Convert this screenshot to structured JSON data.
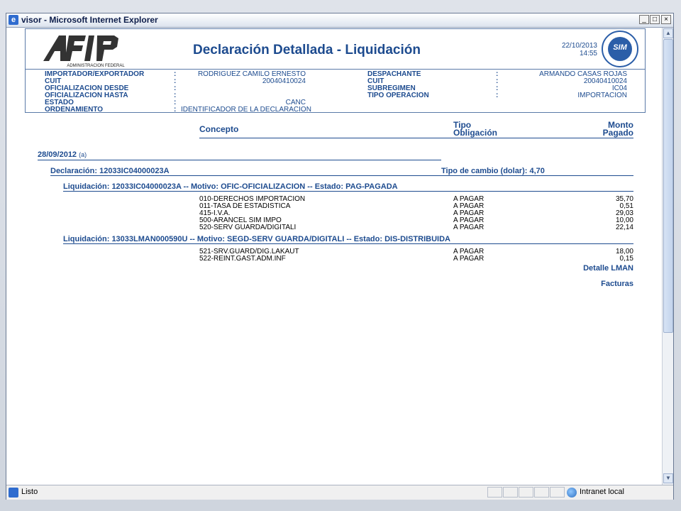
{
  "window": {
    "title": "visor - Microsoft Internet Explorer",
    "buttons": {
      "minimize": "_",
      "maximize": "□",
      "close": "×"
    }
  },
  "header": {
    "logo_text": "AFIP",
    "logo_subtitle": "ADMINISTRACION FEDERAL",
    "title": "Declaración Detallada - Liquidación",
    "date": "22/10/2013",
    "time": "14:55",
    "seal_text": "SIM"
  },
  "info": {
    "left": [
      {
        "label": "IMPORTADOR/EXPORTADOR",
        "value": "RODRIGUEZ CAMILO ERNESTO"
      },
      {
        "label": "CUIT",
        "value": "20040410024"
      },
      {
        "label": "OFICIALIZACION DESDE",
        "value": ""
      },
      {
        "label": "OFICIALIZACION HASTA",
        "value": ""
      },
      {
        "label": "ESTADO",
        "value": "CANC"
      },
      {
        "label": "ORDENAMIENTO",
        "value": "IDENTIFICADOR DE LA DECLARACION"
      }
    ],
    "right": [
      {
        "label": "DESPACHANTE",
        "value": "ARMANDO CASAS ROJAS"
      },
      {
        "label": "CUIT",
        "value": "20040410024"
      },
      {
        "label": "SUBREGIMEN",
        "value": "IC04"
      },
      {
        "label": "TIPO OPERACION",
        "value": "IMPORTACION"
      }
    ]
  },
  "columns": {
    "concepto": "Concepto",
    "tipo_1": "Tipo",
    "tipo_2": "Obligación",
    "monto_1": "Monto",
    "monto_2": "Pagado"
  },
  "date_group": {
    "date": "28/09/2012",
    "note": "(a)"
  },
  "declaracion": {
    "label": "Declaración: 12033IC04000023A",
    "tipo_cambio": "Tipo de cambio (dolar): 4,70"
  },
  "liquidaciones": [
    {
      "title": "Liquidación: 12033IC04000023A  -- Motivo: OFIC-OFICIALIZACION  -- Estado: PAG-PAGADA",
      "items": [
        {
          "concepto": "010-DERECHOS IMPORTACION",
          "tipo": "A PAGAR",
          "monto": "35,70"
        },
        {
          "concepto": "011-TASA DE ESTADISTICA",
          "tipo": "A PAGAR",
          "monto": "0,51"
        },
        {
          "concepto": "415-I.V.A.",
          "tipo": "A PAGAR",
          "monto": "29,03"
        },
        {
          "concepto": "500-ARANCEL SIM IMPO",
          "tipo": "A PAGAR",
          "monto": "10,00"
        },
        {
          "concepto": "520-SERV GUARDA/DIGITALI",
          "tipo": "A PAGAR",
          "monto": "22,14"
        }
      ]
    },
    {
      "title": "Liquidación: 13033LMAN000590U  -- Motivo: SEGD-SERV GUARDA/DIGITALI  -- Estado: DIS-DISTRIBUIDA",
      "items": [
        {
          "concepto": "521-SRV.GUARD/DIG.LAKAUT",
          "tipo": "A PAGAR",
          "monto": "18,00"
        },
        {
          "concepto": "522-REINT.GAST.ADM.INF",
          "tipo": "A PAGAR",
          "monto": "0,15"
        }
      ]
    }
  ],
  "links": {
    "detalle": "Detalle LMAN",
    "facturas": "Facturas"
  },
  "statusbar": {
    "status": "Listo",
    "zone": "Intranet local"
  }
}
